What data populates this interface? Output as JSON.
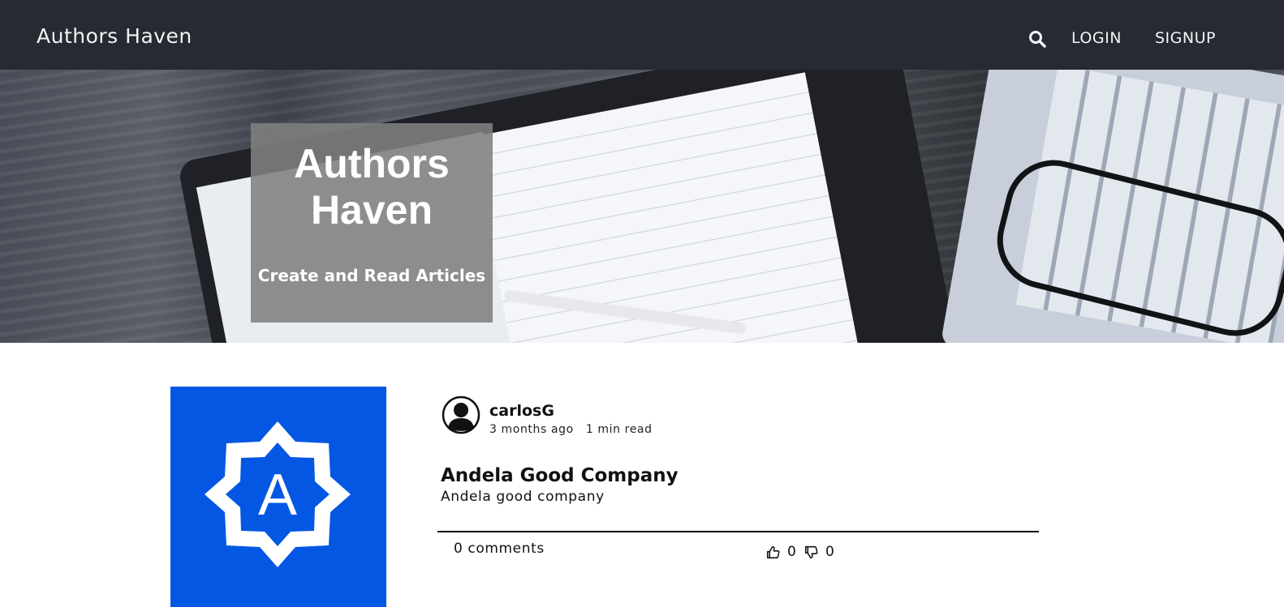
{
  "navbar": {
    "brand": "Authors Haven",
    "search_icon": "search-icon",
    "login_label": "LOGIN",
    "signup_label": "SIGNUP"
  },
  "hero": {
    "title": "Authors Haven",
    "subtitle": "Create and Read Articles"
  },
  "article": {
    "thumbnail_letter": "A",
    "author": "carlosG",
    "time_ago": "3 months ago",
    "read_time": "1 min read",
    "title": "Andela Good Company",
    "description": "Andela good company",
    "comments": "0 comments",
    "likes": "0",
    "dislikes": "0"
  },
  "colors": {
    "navbar_bg": "#262a33",
    "thumbnail_bg": "#0357e3",
    "hero_overlay": "#808080"
  }
}
